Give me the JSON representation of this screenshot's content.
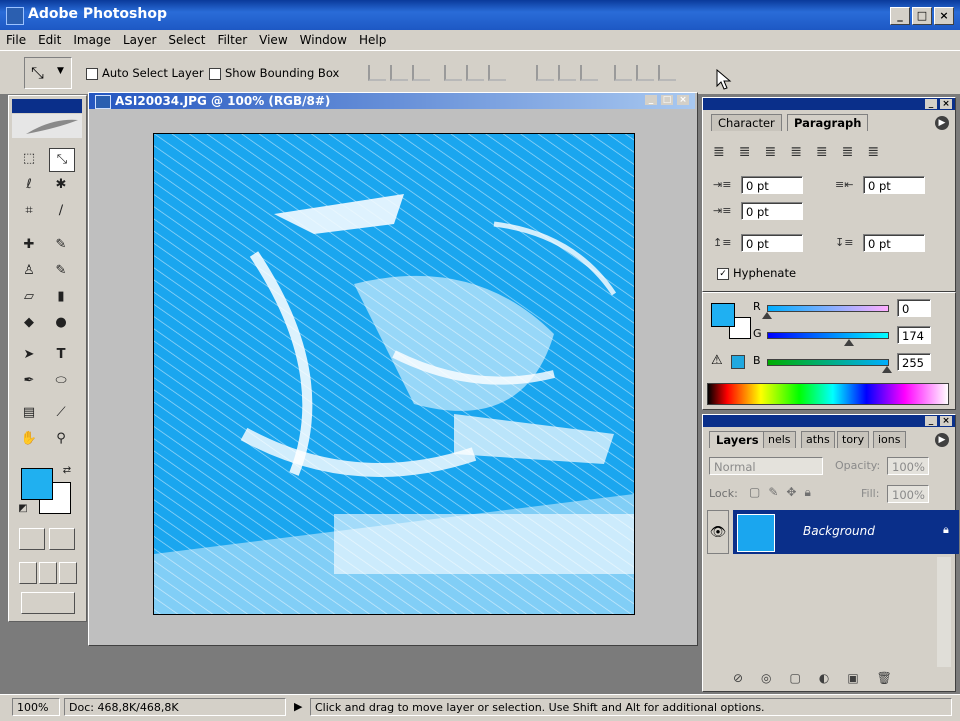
{
  "app": {
    "title": "Adobe Photoshop"
  },
  "window_buttons": [
    "_",
    "□",
    "×"
  ],
  "menu": [
    "File",
    "Edit",
    "Image",
    "Layer",
    "Select",
    "Filter",
    "View",
    "Window",
    "Help"
  ],
  "options": {
    "auto_select_label": "Auto Select Layer",
    "bounding_box_label": "Show Bounding Box"
  },
  "document": {
    "title": "ASI20034.JPG @ 100% (RGB/8#)"
  },
  "colors": {
    "foreground": "#1fb0f2",
    "background": "#ffffff",
    "accent": "#0a2f8a"
  },
  "paragraph": {
    "tabs": [
      "Character",
      "Paragraph"
    ],
    "indent_left": "0 pt",
    "indent_right": "0 pt",
    "indent_first": "0 pt",
    "space_before": "0 pt",
    "space_after": "0 pt",
    "hyphenate_label": "Hyphenate",
    "hyphenate_checked": true
  },
  "color_palette": {
    "r_label": "R",
    "g_label": "G",
    "b_label": "B",
    "r": "0",
    "g": "174",
    "b": "255",
    "r_frac": 0.0,
    "g_frac": 0.68,
    "b_frac": 1.0
  },
  "layers": {
    "tabs": [
      "Layers",
      "nels",
      "aths",
      "tory",
      "ions"
    ],
    "blend_mode": "Normal",
    "opacity_label": "Opacity:",
    "opacity": "100%",
    "lock_label": "Lock:",
    "fill_label": "Fill:",
    "fill": "100%",
    "items": [
      {
        "name": "Background"
      }
    ]
  },
  "status": {
    "zoom": "100%",
    "doc": "Doc: 468,8K/468,8K",
    "hint": "Click and drag to move layer or selection.  Use Shift and Alt for additional options."
  }
}
